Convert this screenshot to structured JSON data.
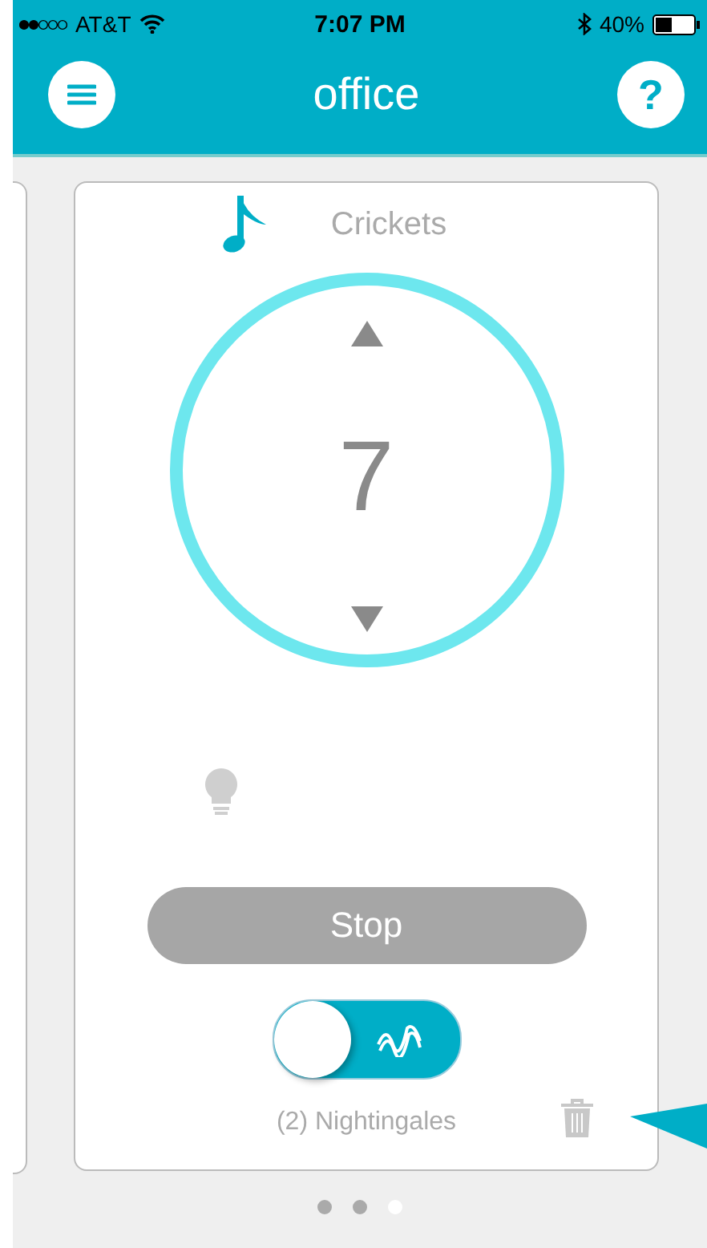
{
  "status_bar": {
    "carrier": "AT&T",
    "time": "7:07 PM",
    "battery": "40%"
  },
  "header": {
    "title": "office",
    "help": "?"
  },
  "card": {
    "sound": "Crickets",
    "value": "7",
    "light_on": false,
    "button": "Stop",
    "toggle_on": true,
    "footer": "(2) Nightingales"
  },
  "pages": [
    {
      "selected": false
    },
    {
      "selected": false
    },
    {
      "selected": true
    }
  ]
}
